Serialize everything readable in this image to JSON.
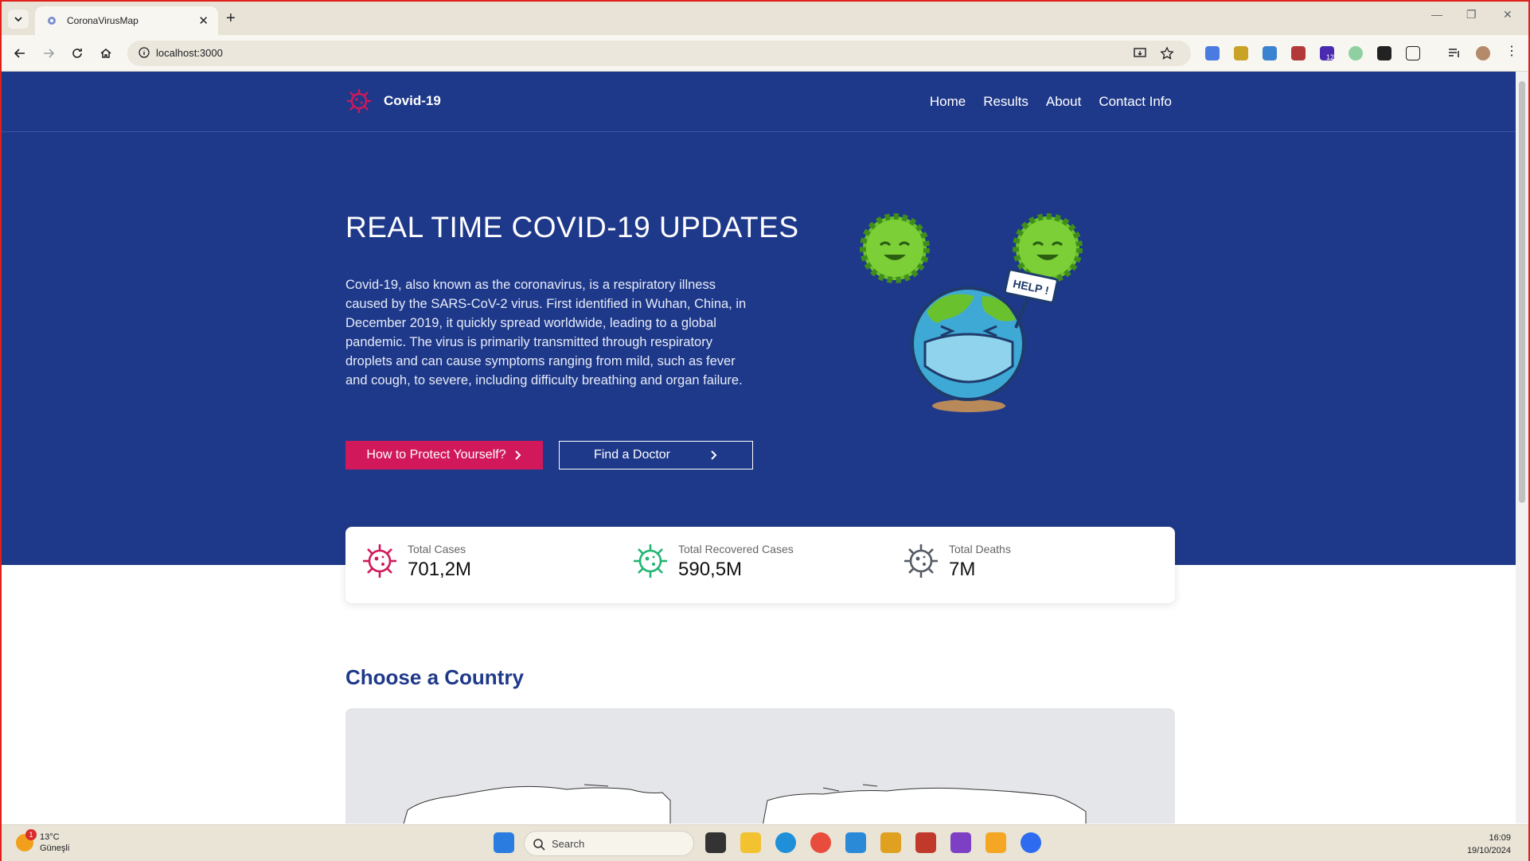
{
  "browser": {
    "tab_title": "CoronaVirusMap",
    "url": "localhost:3000"
  },
  "nav": {
    "brand": "Covid-19",
    "links": [
      "Home",
      "Results",
      "About",
      "Contact Info"
    ]
  },
  "hero": {
    "title": "REAL TIME COVID-19 UPDATES",
    "description": "Covid-19, also known as the coronavirus, is a respiratory illness caused by the SARS-CoV-2 virus. First identified in Wuhan, China, in December 2019, it quickly spread worldwide, leading to a global pandemic. The virus is primarily transmitted through respiratory droplets and can cause symptoms ranging from mild, such as fever and cough, to severe, including difficulty breathing and organ failure.",
    "protect_button": "How to Protect Yourself?",
    "doctor_button": "Find a Doctor",
    "illustration_sign": "HELP !"
  },
  "stats": [
    {
      "label": "Total Cases",
      "value": "701,2M",
      "color": "#d1185a"
    },
    {
      "label": "Total Recovered Cases",
      "value": "590,5M",
      "color": "#22b573"
    },
    {
      "label": "Total Deaths",
      "value": "7M",
      "color": "#555b66"
    }
  ],
  "section": {
    "choose_title": "Choose a Country"
  },
  "taskbar": {
    "temp": "13°C",
    "weather": "Güneşli",
    "weather_badge": "1",
    "search": "Search",
    "time": "16:09",
    "date": "19/10/2024",
    "ext_badge": "12"
  },
  "colors": {
    "hero_bg": "#1f398a",
    "accent": "#d1185a"
  }
}
